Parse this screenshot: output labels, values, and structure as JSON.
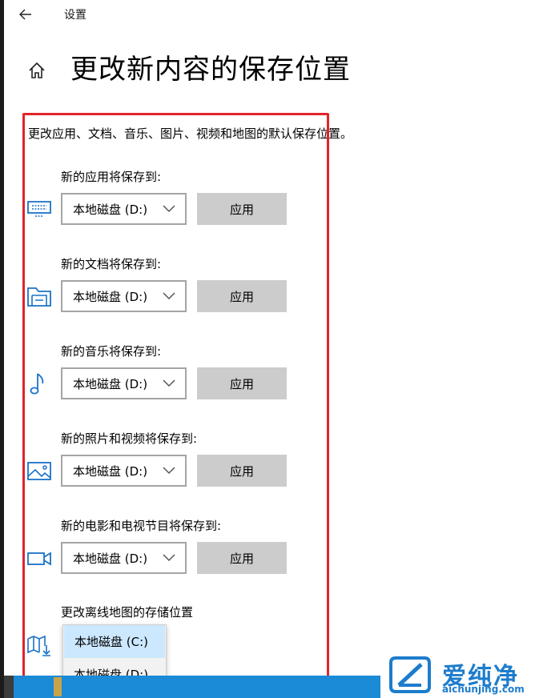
{
  "window": {
    "title": "设置"
  },
  "heading": "更改新内容的保存位置",
  "description": "更改应用、文档、音乐、图片、视频和地图的默认保存位置。",
  "sections": [
    {
      "label": "新的应用将保存到:",
      "icon": "monitor-icon",
      "selected": "本地磁盘 (D:)",
      "button": "应用"
    },
    {
      "label": "新的文档将保存到:",
      "icon": "document-folder-icon",
      "selected": "本地磁盘 (D:)",
      "button": "应用"
    },
    {
      "label": "新的音乐将保存到:",
      "icon": "music-note-icon",
      "selected": "本地磁盘 (D:)",
      "button": "应用"
    },
    {
      "label": "新的照片和视频将保存到:",
      "icon": "picture-icon",
      "selected": "本地磁盘 (D:)",
      "button": "应用"
    },
    {
      "label": "新的电影和电视节目将保存到:",
      "icon": "video-camera-icon",
      "selected": "本地磁盘 (D:)",
      "button": "应用"
    }
  ],
  "maps": {
    "label": "更改离线地图的存储位置",
    "icon": "map-download-icon",
    "options": [
      "本地磁盘 (C:)",
      "本地磁盘 (D:)"
    ],
    "highlighted_option": "本地磁盘 (C:)"
  },
  "watermark": {
    "cn": "爱纯净",
    "en": "aichunjing.com"
  },
  "colors": {
    "accent": "#0078d7",
    "highlight_border": "#e3232a",
    "button_bg": "#cccccc",
    "dropdown_selected": "#cce8ff"
  }
}
